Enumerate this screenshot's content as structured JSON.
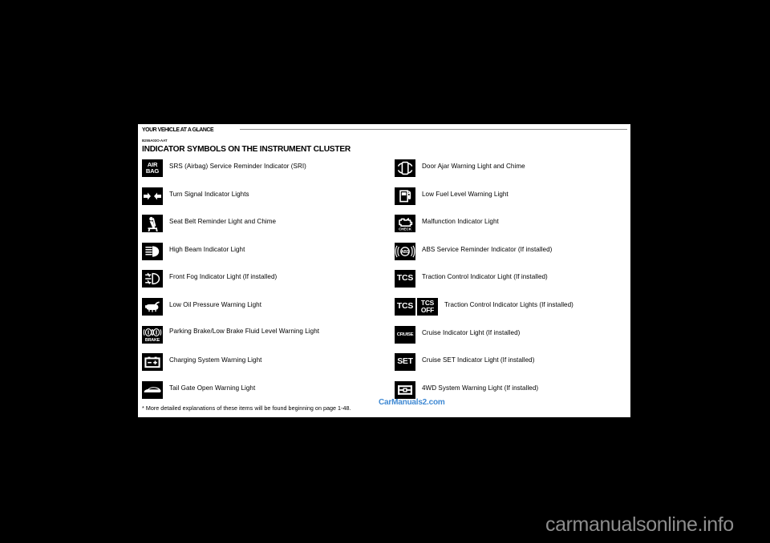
{
  "header": {
    "running_title": "YOUR VEHICLE AT A GLANCE",
    "section_code": "B255A03O-AAT",
    "section_title": "INDICATOR SYMBOLS ON THE INSTRUMENT CLUSTER"
  },
  "left_column": [
    {
      "icon": "airbag-icon",
      "icon_text": "AIR\nBAG",
      "label": "SRS (Airbag) Service Reminder Indicator (SRI)"
    },
    {
      "icon": "turn-signal-icon",
      "icon_text": "",
      "label": "Turn Signal Indicator Lights"
    },
    {
      "icon": "seat-belt-icon",
      "icon_text": "",
      "label": "Seat Belt Reminder Light and Chime"
    },
    {
      "icon": "high-beam-icon",
      "icon_text": "",
      "label": "High Beam Indicator Light"
    },
    {
      "icon": "front-fog-icon",
      "icon_text": "",
      "label": "Front Fog Indicator Light (If installed)"
    },
    {
      "icon": "low-oil-pressure-icon",
      "icon_text": "",
      "label": "Low Oil Pressure Warning Light"
    },
    {
      "icon": "parking-brake-icon",
      "icon_text": "BRAKE",
      "label": "Parking Brake/Low Brake Fluid Level Warning Light"
    },
    {
      "icon": "battery-charging-icon",
      "icon_text": "",
      "label": "Charging System Warning Light"
    },
    {
      "icon": "tail-gate-open-icon",
      "icon_text": "",
      "label": "Tail Gate Open Warning Light"
    }
  ],
  "right_column": [
    {
      "icon": "door-ajar-icon",
      "icon_text": "",
      "label": "Door Ajar Warning Light and Chime"
    },
    {
      "icon": "low-fuel-icon",
      "icon_text": "",
      "label": "Low Fuel Level Warning Light"
    },
    {
      "icon": "check-engine-icon",
      "icon_text": "CHECK",
      "label": "Malfunction Indicator Light"
    },
    {
      "icon": "abs-icon",
      "icon_text": "ABS",
      "label": "ABS Service Reminder Indicator (If installed)"
    },
    {
      "icon": "tcs-icon",
      "icon_text": "TCS",
      "label": "Traction Control Indicator Light (If installed)"
    },
    {
      "icon": "tcs-pair-icon",
      "icon_text": "TCS",
      "icon_text_2": "TCS\nOFF",
      "label": "Traction Control Indicator Lights (If installed)"
    },
    {
      "icon": "cruise-icon",
      "icon_text": "CRUISE",
      "label": "Cruise Indicator Light (If installed)"
    },
    {
      "icon": "cruise-set-icon",
      "icon_text": "SET",
      "label": "Cruise SET Indicator Light (If installed)"
    },
    {
      "icon": "four-wd-icon",
      "icon_text": "",
      "label": "4WD System Warning Light (If installed)"
    }
  ],
  "footnote": "* More detailed explanations of these items will be found beginning on page 1-48.",
  "watermarks": {
    "inner": "CarManuals2.com",
    "bottom": "carmanualsonline.info"
  },
  "colors": {
    "page_background": "#ffffff",
    "canvas_background": "#000000",
    "icon_background": "#000000",
    "icon_foreground": "#ffffff",
    "watermark_inner": "#2f7fd0",
    "watermark_bottom": "#8d8d8d",
    "rule": "#8c8c8c"
  }
}
